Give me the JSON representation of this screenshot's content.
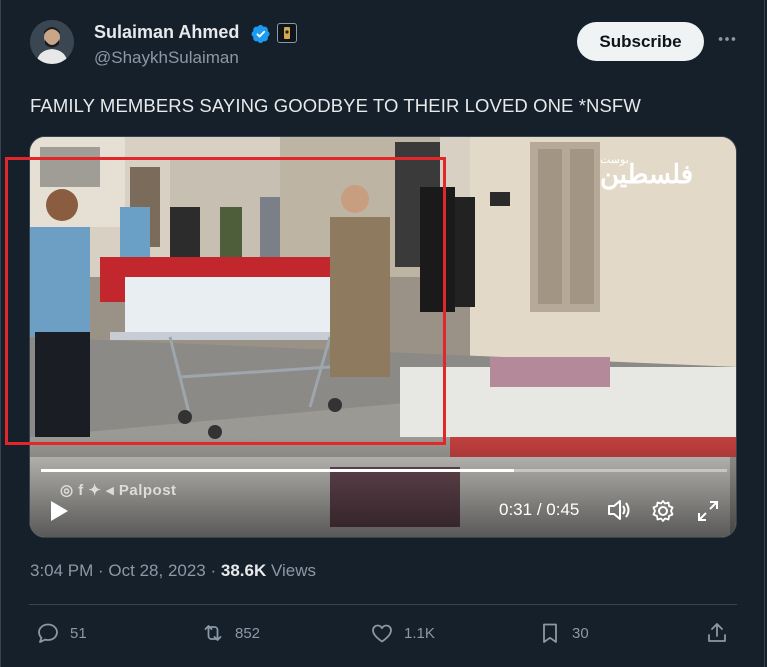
{
  "author": {
    "display_name": "Sulaiman Ahmed",
    "handle": "@ShaykhSulaiman",
    "verified": true,
    "avatar_icon": "profile-photo"
  },
  "header": {
    "subscribe_label": "Subscribe",
    "more_icon": "more-horizontal-icon"
  },
  "post": {
    "text": "FAMILY MEMBERS SAYING GOODBYE TO THEIR LOVED ONE *NSFW"
  },
  "video": {
    "watermark_top": "فلسطين",
    "watermark_top_small": "بوست",
    "watermark_bottom": "Palpost",
    "time_current": "0:31",
    "time_separator": " / ",
    "time_total": "0:45",
    "progress_fraction": 0.69,
    "highlight_color": "#e3262a"
  },
  "meta": {
    "time": "3:04 PM",
    "sep1": " · ",
    "date": "Oct 28, 2023",
    "sep2": " · ",
    "views_count": "38.6K",
    "views_label": " Views"
  },
  "actions": {
    "replies": "51",
    "reposts": "852",
    "likes": "1.1K",
    "bookmarks": "30"
  },
  "colors": {
    "background": "#15202b",
    "accent": "#1d9bf0",
    "muted": "#8b98a5",
    "text": "#e7e9ea"
  }
}
